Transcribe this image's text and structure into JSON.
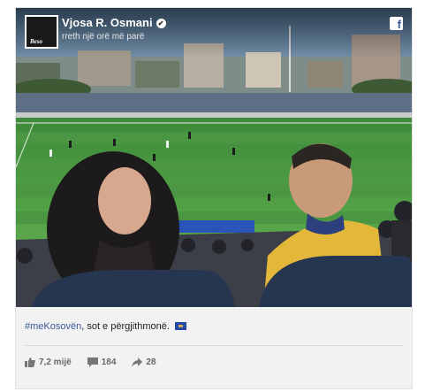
{
  "post": {
    "author": "Vjosa R. Osmani",
    "time": "rreth një orë më parë",
    "avatar_text": "Beso",
    "hashtag": "#meKosovën",
    "caption_rest": ", sot e përgjithmonë.",
    "likes": "7,2 mijë",
    "comments": "184",
    "shares": "28"
  },
  "icons": {
    "verified": "verified-check-icon",
    "platform": "facebook-icon",
    "like": "thumbs-up-icon",
    "comment": "comment-icon",
    "share": "share-arrow-icon",
    "flag": "kosovo-flag-emoji"
  },
  "colors": {
    "link": "#3b5998",
    "card_bg": "#f2f2f2",
    "meta_text": "#666666"
  }
}
